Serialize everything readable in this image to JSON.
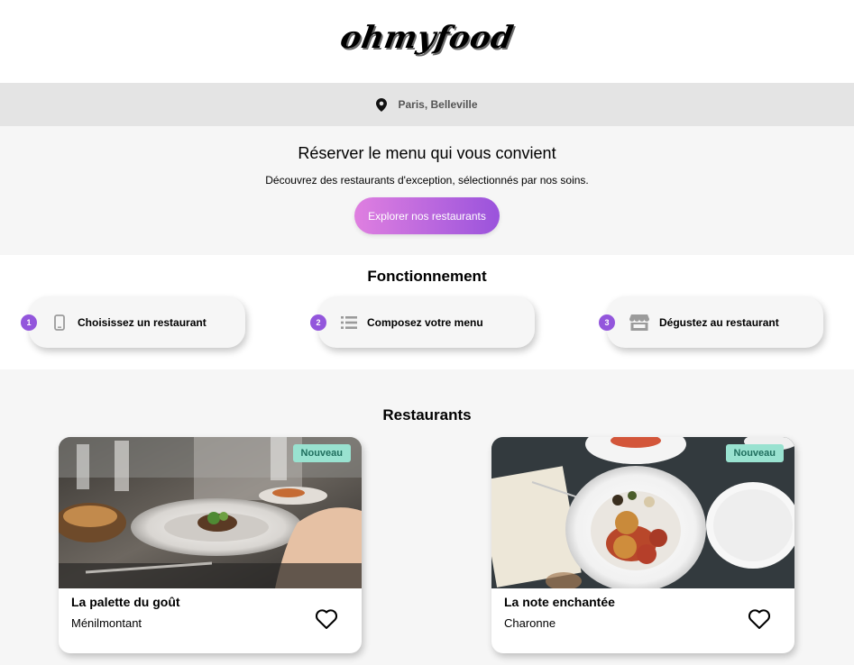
{
  "header": {
    "logo": "ohmyfood"
  },
  "location": {
    "icon": "map-pin-icon",
    "text": "Paris, Belleville"
  },
  "hero": {
    "title": "Réserver le menu qui vous convient",
    "subtitle": "Découvrez des restaurants d'exception, sélectionnés par nos soins.",
    "cta_label": "Explorer nos restaurants"
  },
  "how_it_works": {
    "title": "Fonctionnement",
    "steps": [
      {
        "number": "1",
        "icon": "mobile-phone-icon",
        "label": "Choisissez un restaurant"
      },
      {
        "number": "2",
        "icon": "list-icon",
        "label": "Composez votre menu"
      },
      {
        "number": "3",
        "icon": "store-icon",
        "label": "Dégustez au restaurant"
      }
    ]
  },
  "restaurants": {
    "title": "Restaurants",
    "cards": [
      {
        "badge": "Nouveau",
        "name": "La palette du goût",
        "area": "Ménilmontant",
        "favorite_icon": "heart-outline-icon"
      },
      {
        "badge": "Nouveau",
        "name": "La note enchantée",
        "area": "Charonne",
        "favorite_icon": "heart-outline-icon"
      }
    ]
  },
  "colors": {
    "accent_purple": "#9356dc",
    "cta_gradient_start": "#df7fe0",
    "cta_gradient_end": "#9a53dc",
    "badge_bg": "#99e2d0",
    "location_bar_bg": "#e4e4e4",
    "page_bg": "#f6f6f6"
  }
}
